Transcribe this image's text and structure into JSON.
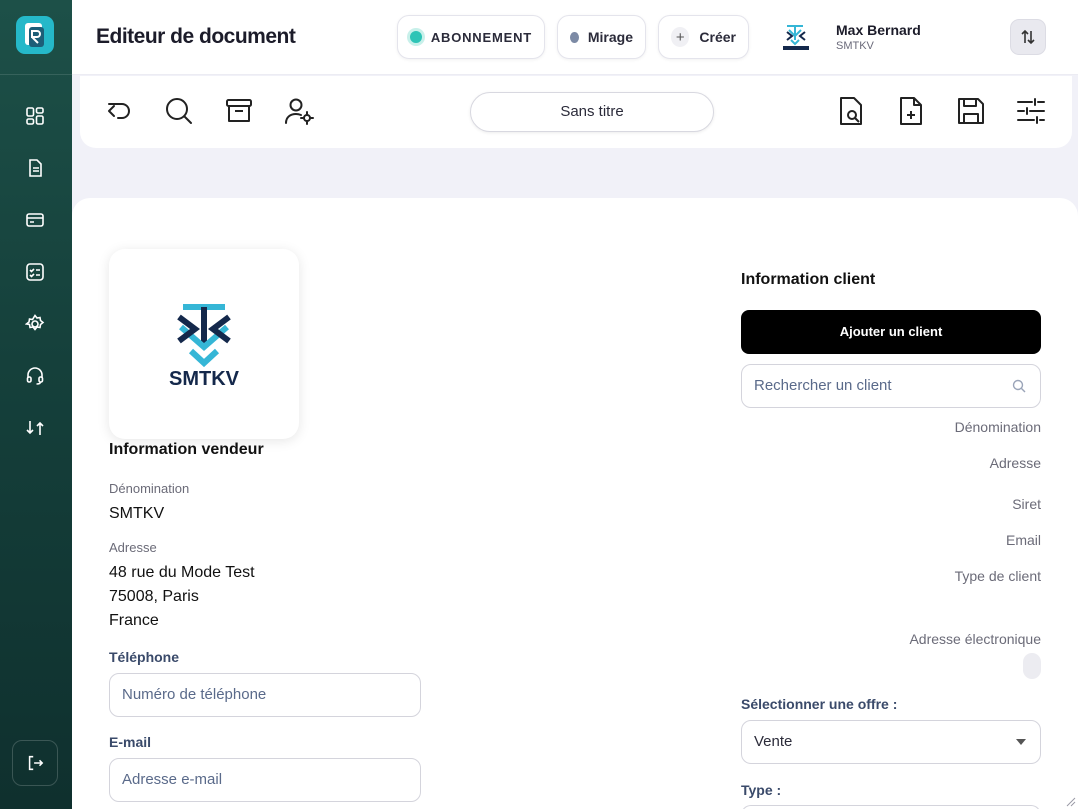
{
  "header": {
    "title": "Editeur de document",
    "abonnement_label": "ABONNEMENT",
    "mirage_label": "Mirage",
    "creer_label": "Créer",
    "user_name": "Max Bernard",
    "user_company": "SMTKV"
  },
  "toolbar": {
    "document_name": "Sans titre"
  },
  "vendor": {
    "logo_text": "SMTKV",
    "section_title": "Information vendeur",
    "denomination_label": "Dénomination",
    "denomination_value": "SMTKV",
    "adresse_label": "Adresse",
    "adresse_line1": "48 rue du Mode Test",
    "adresse_line2": "75008, Paris",
    "adresse_line3": "France",
    "telephone_label": "Téléphone",
    "telephone_placeholder": "Numéro de téléphone",
    "email_label": "E-mail",
    "email_placeholder": "Adresse e-mail"
  },
  "client": {
    "section_title": "Information client",
    "add_button": "Ajouter un client",
    "search_placeholder": "Rechercher un client",
    "denomination_label": "Dénomination",
    "adresse_label": "Adresse",
    "siret_label": "Siret",
    "email_label": "Email",
    "type_label": "Type de client",
    "adresse_electronique_label": "Adresse électronique",
    "offre_label": "Sélectionner une offre :",
    "offre_value": "Vente",
    "type_field_label": "Type :"
  },
  "colors": {
    "sidebar": "#15403b",
    "accent_teal": "#25b8c9",
    "logo_navy": "#14284b",
    "logo_cyan": "#35b6d6"
  }
}
